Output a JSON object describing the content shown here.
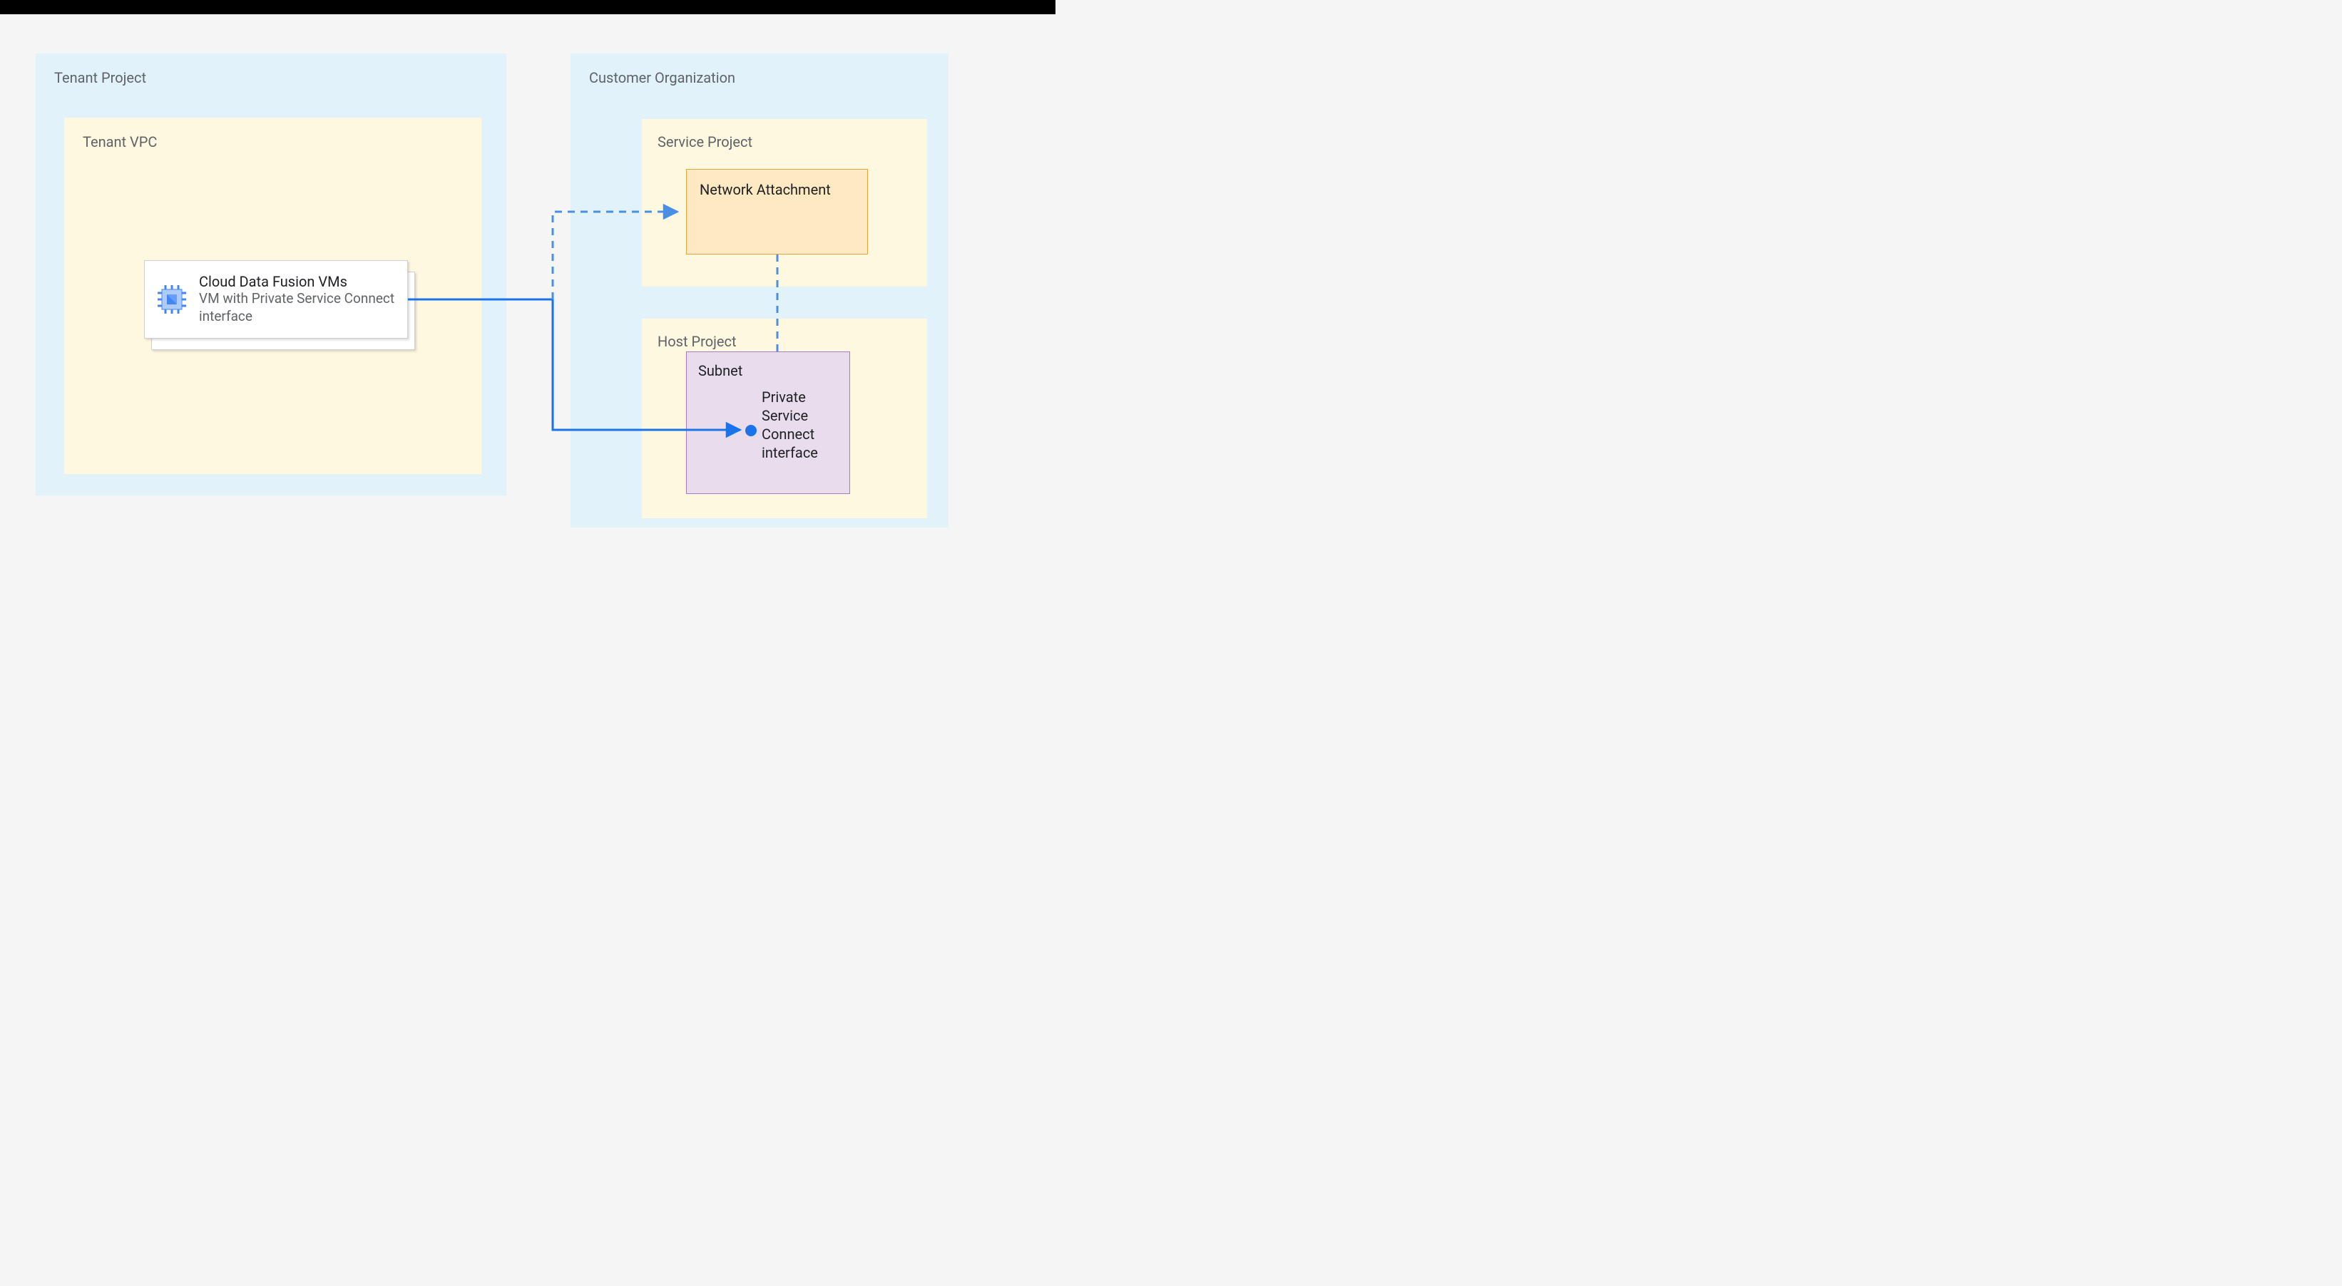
{
  "tenant_project": {
    "label": "Tenant Project"
  },
  "tenant_vpc": {
    "label": "Tenant VPC"
  },
  "vm_card": {
    "title": "Cloud Data Fusion VMs",
    "subtitle": "VM with Private Service Connect interface"
  },
  "customer_org": {
    "label": "Customer Organization"
  },
  "service_project": {
    "label": "Service Project"
  },
  "network_attachment": {
    "label": "Network Attachment"
  },
  "host_project": {
    "label": "Host Project"
  },
  "subnet": {
    "label": "Subnet",
    "psc_interface": "Private Service Connect interface"
  },
  "colors": {
    "blue": "#1a73e8",
    "light_blue_bg": "#e1f2fb",
    "light_yellow_bg": "#fff8e1",
    "orange_border": "#e8a33d",
    "orange_fill": "#ffe9c2",
    "purple_border": "#a97cbf",
    "purple_fill": "#e8dced"
  }
}
